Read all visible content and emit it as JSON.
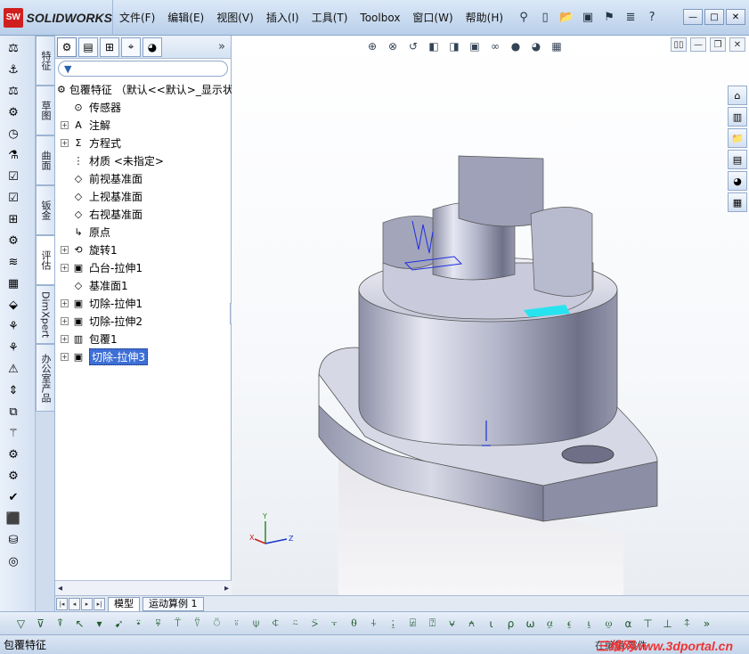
{
  "app": {
    "logo_text": "SOLIDWORKS",
    "logo_mark": "SW"
  },
  "menu": [
    "文件(F)",
    "编辑(E)",
    "视图(V)",
    "插入(I)",
    "工具(T)",
    "Toolbox",
    "窗口(W)",
    "帮助(H)"
  ],
  "side_tabs": [
    "特征",
    "草图",
    "曲面",
    "钣金",
    "评估",
    "DimXpert",
    "办公室产品"
  ],
  "active_side_tab": "评估",
  "tree": {
    "root": "包覆特征 （默认<<默认>_显示状",
    "items": [
      {
        "label": "传感器",
        "expand": false,
        "icon": "sensor-icon"
      },
      {
        "label": "注解",
        "expand": true,
        "icon": "annotation-icon"
      },
      {
        "label": "方程式",
        "expand": true,
        "icon": "equation-icon"
      },
      {
        "label": "材质 <未指定>",
        "expand": false,
        "icon": "material-icon"
      },
      {
        "label": "前视基准面",
        "expand": false,
        "icon": "plane-icon"
      },
      {
        "label": "上视基准面",
        "expand": false,
        "icon": "plane-icon"
      },
      {
        "label": "右视基准面",
        "expand": false,
        "icon": "plane-icon"
      },
      {
        "label": "原点",
        "expand": false,
        "icon": "origin-icon"
      },
      {
        "label": "旋转1",
        "expand": true,
        "icon": "revolve-icon"
      },
      {
        "label": "凸台-拉伸1",
        "expand": true,
        "icon": "extrude-icon"
      },
      {
        "label": "基准面1",
        "expand": false,
        "icon": "plane-icon"
      },
      {
        "label": "切除-拉伸1",
        "expand": true,
        "icon": "cut-icon"
      },
      {
        "label": "切除-拉伸2",
        "expand": true,
        "icon": "cut-icon"
      },
      {
        "label": "包覆1",
        "expand": true,
        "icon": "wrap-icon"
      },
      {
        "label": "切除-拉伸3",
        "expand": true,
        "icon": "cut-icon",
        "selected": true
      }
    ]
  },
  "model_tabs": [
    "模型",
    "运动算例 1"
  ],
  "active_model_tab": "模型",
  "status": {
    "text": "包覆特征",
    "edit_state": "在编辑 零件",
    "watermark": "三维网www.3dportal.cn"
  },
  "axes": {
    "x": "X",
    "y": "Y",
    "z": "Z"
  }
}
